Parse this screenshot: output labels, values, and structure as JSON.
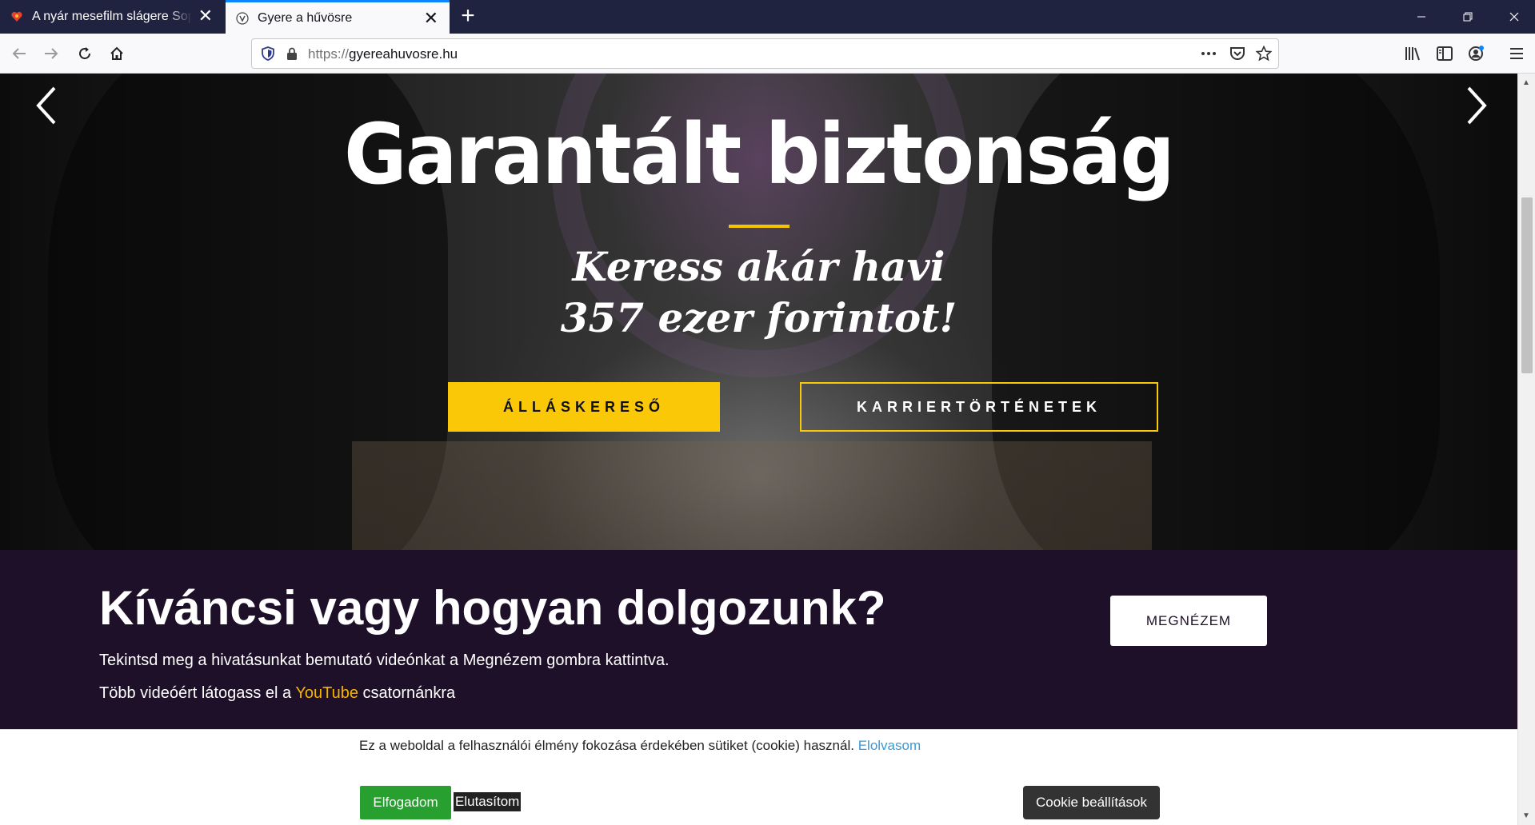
{
  "browser": {
    "tabs": [
      {
        "title": "A nyár mesefilm slágere Sopron",
        "favicon": "heart-icon",
        "active": false
      },
      {
        "title": "Gyere a hűvösre",
        "favicon": "police-emblem-icon",
        "active": true
      }
    ],
    "url_protocol": "https://",
    "url_host": "gyereahuvosre.hu",
    "accent_color": "#0a84ff"
  },
  "hero": {
    "title": "Garantált biztonság",
    "subtitle_line1": "Keress akár havi",
    "subtitle_line2": "357 ezer forintot!",
    "jobs_button": "ÁLLÁSKERESŐ",
    "stories_button": "KARRIERTÖRTÉNETEK",
    "accent_color": "#fbc808"
  },
  "video_section": {
    "title": "Kíváncsi vagy hogyan dolgozunk?",
    "text1": "Tekintsd meg a hivatásunkat bemutató videónkat a Megnézem gombra kattintva.",
    "text2_prefix": "Több videóért látogass el a",
    "text2_link": "YouTube",
    "text2_suffix": "csatornánkra",
    "watch_button": "MEGNÉZEM",
    "background_color": "#1e1029"
  },
  "cookie_bar": {
    "text": "Ez a weboldal a felhasználói élmény fokozása érdekében sütiket (cookie) használ.",
    "read_more": "Elolvasom",
    "accept": "Elfogadom",
    "reject": "Elutasítom",
    "settings": "Cookie beállítások",
    "accept_color": "#27a02f"
  }
}
